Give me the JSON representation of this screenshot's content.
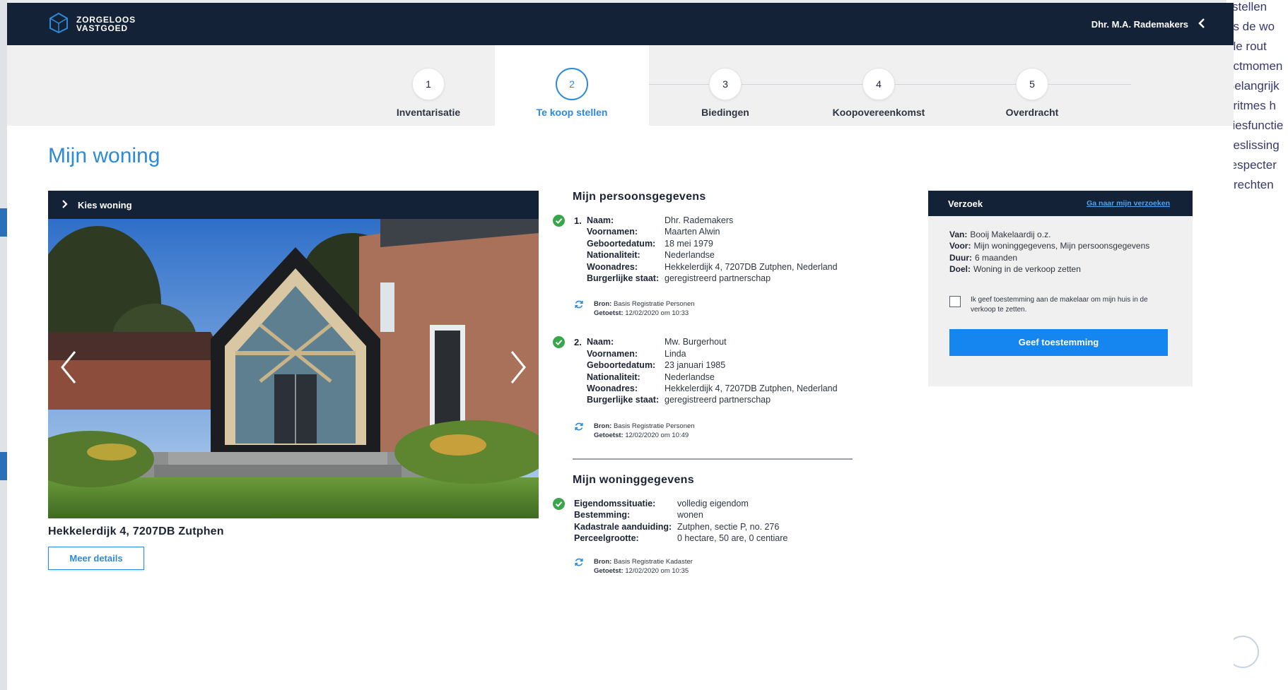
{
  "background": {
    "fragments": [
      "stellen",
      "ns de wo",
      "ale rout",
      "actmomen",
      "Belangrijk",
      "oritmes h",
      "viesfunctie",
      "beslissing",
      "respecter",
      "rechten"
    ]
  },
  "header": {
    "brand_line1": "ZORGELOOS",
    "brand_line2": "VASTGOED",
    "user_name": "Dhr. M.A. Rademakers",
    "logo_icon": "house-outline-icon",
    "menu_icon": "chevron-left-icon"
  },
  "steps": [
    {
      "number": "1",
      "label": "Inventarisatie"
    },
    {
      "number": "2",
      "label": "Te koop stellen"
    },
    {
      "number": "3",
      "label": "Biedingen"
    },
    {
      "number": "4",
      "label": "Koopovereenkomst"
    },
    {
      "number": "5",
      "label": "Overdracht"
    }
  ],
  "active_step": "2",
  "page_title": "Mijn woning",
  "house": {
    "select_label": "Kies woning",
    "address": "Hekkelerdijk 4, 7207DB Zutphen",
    "details_button": "Meer details"
  },
  "personal": {
    "title": "Mijn persoonsgegevens",
    "persons": [
      {
        "index": "1.",
        "fields": [
          {
            "label": "Naam:",
            "value": "Dhr. Rademakers"
          },
          {
            "label": "Voornamen:",
            "value": "Maarten Alwin"
          },
          {
            "label": "Geboortedatum:",
            "value": "18 mei 1979"
          },
          {
            "label": "Nationaliteit:",
            "value": "Nederlandse"
          },
          {
            "label": "Woonadres:",
            "value": "Hekkelerdijk 4, 7207DB Zutphen, Nederland"
          },
          {
            "label": "Burgerlijke staat:",
            "value": "geregistreerd partnerschap"
          }
        ],
        "source_label": "Bron:",
        "source": "Basis Registratie Personen",
        "checked_label": "Getoetst:",
        "checked": "12/02/2020 om 10:33"
      },
      {
        "index": "2.",
        "fields": [
          {
            "label": "Naam:",
            "value": "Mw. Burgerhout"
          },
          {
            "label": "Voornamen:",
            "value": "Linda"
          },
          {
            "label": "Geboortedatum:",
            "value": "23 januari 1985"
          },
          {
            "label": "Nationaliteit:",
            "value": "Nederlandse"
          },
          {
            "label": "Woonadres:",
            "value": "Hekkelerdijk 4, 7207DB Zutphen, Nederland"
          },
          {
            "label": "Burgerlijke staat:",
            "value": "geregistreerd partnerschap"
          }
        ],
        "source_label": "Bron:",
        "source": "Basis Registratie Personen",
        "checked_label": "Getoetst:",
        "checked": "12/02/2020 om 10:49"
      }
    ]
  },
  "property": {
    "title": "Mijn woninggegevens",
    "fields": [
      {
        "label": "Eigendomssituatie:",
        "value": "volledig eigendom"
      },
      {
        "label": "Bestemming:",
        "value": "wonen"
      },
      {
        "label": "Kadastrale aanduiding:",
        "value": "Zutphen, sectie P, no. 276"
      },
      {
        "label": "Perceelgrootte:",
        "value": "0 hectare, 50 are, 0 centiare"
      }
    ],
    "source_label": "Bron:",
    "source": "Basis Registratie Kadaster",
    "checked_label": "Getoetst:",
    "checked": "12/02/2020 om 10:35"
  },
  "request": {
    "title": "Verzoek",
    "link": "Ga naar mijn verzoeken",
    "fields": [
      {
        "label": "Van:",
        "value": "Booij Makelaardij o.z."
      },
      {
        "label": "Voor:",
        "value": "Mijn woninggegevens, Mijn persoonsgegevens"
      },
      {
        "label": "Duur:",
        "value": "6 maanden"
      },
      {
        "label": "Doel:",
        "value": "Woning in de verkoop zetten"
      }
    ],
    "consent_text": "Ik geef toestemming aan de makelaar om mijn huis in de verkoop te zetten.",
    "consent_checked": false,
    "button": "Geef toestemming"
  },
  "colors": {
    "navy": "#142238",
    "accent": "#2d8ad8",
    "button_blue": "#1585f0",
    "success": "#3aa64c"
  }
}
